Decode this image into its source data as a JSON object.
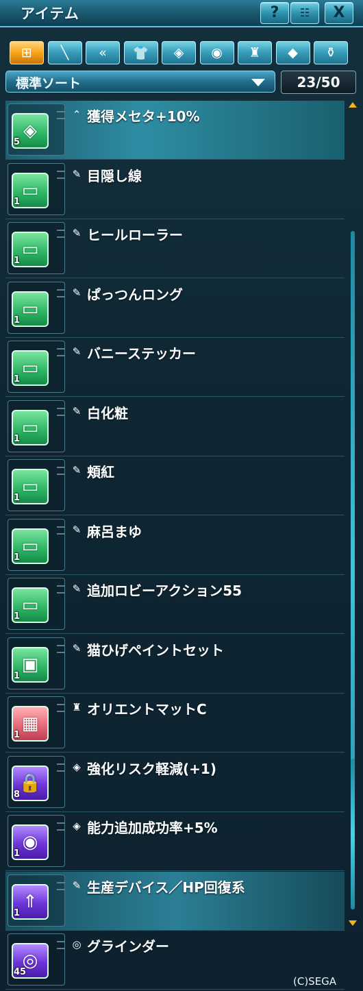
{
  "window": {
    "title": "アイテム"
  },
  "titlebar": {
    "help_label": "?",
    "close_label": "X"
  },
  "tabs": [
    {
      "icon": "grid-icon",
      "glyph": "⊞",
      "active": true
    },
    {
      "icon": "sword-icon",
      "glyph": "╲",
      "active": false
    },
    {
      "icon": "dual-blade-icon",
      "glyph": "«",
      "active": false
    },
    {
      "icon": "shirt-icon",
      "glyph": "👕",
      "active": false
    },
    {
      "icon": "tag-icon",
      "glyph": "◈",
      "active": false
    },
    {
      "icon": "disc-icon",
      "glyph": "◉",
      "active": false
    },
    {
      "icon": "chair-icon",
      "glyph": "♜",
      "active": false
    },
    {
      "icon": "diamond-icon",
      "glyph": "◆",
      "active": false
    },
    {
      "icon": "bag-icon",
      "glyph": "⚱",
      "active": false
    }
  ],
  "sort": {
    "label": "標準ソート"
  },
  "count": {
    "text": "23/50"
  },
  "items": [
    {
      "name": "獲得メセタ+10%",
      "qty": "5",
      "color": "green",
      "glyph": "◈",
      "cat": "⌃",
      "icon": "diamond-ticket-icon",
      "selected": true
    },
    {
      "name": "目隠し線",
      "qty": "1",
      "color": "green",
      "glyph": "▭",
      "cat": "✎",
      "icon": "ticket-icon",
      "selected": false
    },
    {
      "name": "ヒールローラー",
      "qty": "1",
      "color": "green",
      "glyph": "▭",
      "cat": "✎",
      "icon": "ticket-icon",
      "selected": false
    },
    {
      "name": "ぱっつんロング",
      "qty": "1",
      "color": "green",
      "glyph": "▭",
      "cat": "✎",
      "icon": "ticket-icon",
      "selected": false
    },
    {
      "name": "バニーステッカー",
      "qty": "1",
      "color": "green",
      "glyph": "▭",
      "cat": "✎",
      "icon": "ticket-icon",
      "selected": false
    },
    {
      "name": "白化粧",
      "qty": "1",
      "color": "green",
      "glyph": "▭",
      "cat": "✎",
      "icon": "ticket-icon",
      "selected": false
    },
    {
      "name": "頬紅",
      "qty": "1",
      "color": "green",
      "glyph": "▭",
      "cat": "✎",
      "icon": "ticket-icon",
      "selected": false
    },
    {
      "name": "麻呂まゆ",
      "qty": "1",
      "color": "green",
      "glyph": "▭",
      "cat": "✎",
      "icon": "ticket-icon",
      "selected": false
    },
    {
      "name": "追加ロビーアクション55",
      "qty": "1",
      "color": "green",
      "glyph": "▭",
      "cat": "✎",
      "icon": "ticket-icon",
      "selected": false
    },
    {
      "name": "猫ひげペイントセット",
      "qty": "1",
      "color": "green",
      "glyph": "▣",
      "cat": "✎",
      "icon": "box-icon",
      "selected": false
    },
    {
      "name": "オリエントマットC",
      "qty": "1",
      "color": "pink",
      "glyph": "▦",
      "cat": "♜",
      "icon": "mat-icon",
      "selected": false
    },
    {
      "name": "強化リスク軽減(+1)",
      "qty": "8",
      "color": "purple",
      "glyph": "🔒",
      "cat": "◈",
      "icon": "lock-icon",
      "selected": false
    },
    {
      "name": "能力追加成功率+5%",
      "qty": "1",
      "color": "purple",
      "glyph": "◉",
      "cat": "◈",
      "icon": "disc-icon",
      "selected": false
    },
    {
      "name": "生産デバイス／HP回復系",
      "qty": "1",
      "color": "purple",
      "glyph": "⇑",
      "cat": "✎",
      "icon": "upgrade-icon",
      "selected": true
    },
    {
      "name": "グラインダー",
      "qty": "45",
      "color": "purple",
      "glyph": "◎",
      "cat": "◎",
      "icon": "grinder-icon",
      "selected": false
    }
  ],
  "footer": {
    "copyright": "(C)SEGA"
  }
}
